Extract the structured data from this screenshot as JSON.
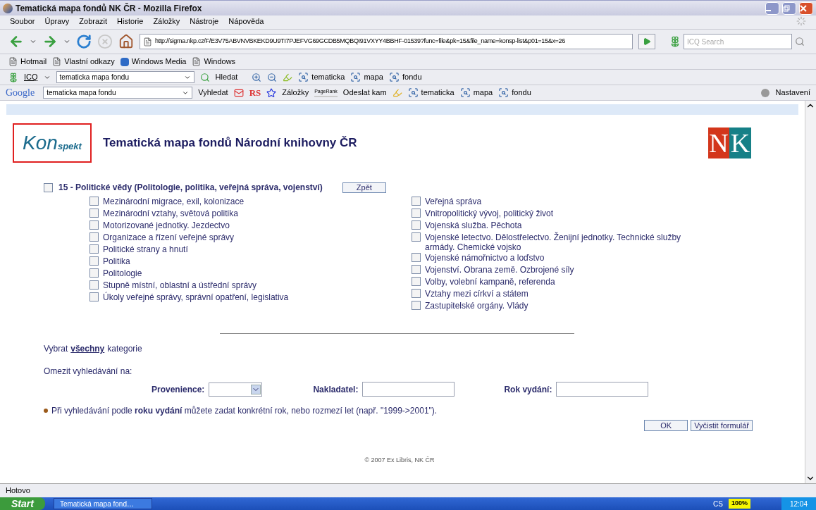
{
  "window": {
    "title": "Tematická mapa fondů NK ČR - Mozilla Firefox"
  },
  "menu": [
    "Soubor",
    "Úpravy",
    "Zobrazit",
    "Historie",
    "Záložky",
    "Nástroje",
    "Nápověda"
  ],
  "navigation": {
    "url": "http://sigma.nkp.cz/F/E3V75ABVNVBKEKD9U9TI7PJEFVG69GCDB5MQBQI91VXYY4BBHF-01539?func=file&pk=15&file_name=konsp-list&p01=15&x=26",
    "search_placeholder": "ICQ Search"
  },
  "bookmarks": [
    {
      "label": "Hotmail",
      "kind": "page"
    },
    {
      "label": "Vlastní odkazy",
      "kind": "page"
    },
    {
      "label": "Windows Media",
      "kind": "media"
    },
    {
      "label": "Windows",
      "kind": "page"
    }
  ],
  "icq_toolbar": {
    "label": "ICQ",
    "query": "tematicka mapa fondu",
    "search": "Hledat",
    "terms": [
      "tematicka",
      "mapa",
      "fondu"
    ]
  },
  "google_toolbar": {
    "logo": "Google",
    "query": "tematicka mapa fondu",
    "search": "Vyhledat",
    "rs": "RS",
    "bookmarks": "Záložky",
    "pagerank": "PageRank",
    "send": "Odeslat kam",
    "terms": [
      "tematicka",
      "mapa",
      "fondu"
    ],
    "settings": "Nastavení"
  },
  "page": {
    "logo": {
      "big": "Kon",
      "small": "spekt"
    },
    "title": "Tematická mapa fondů Národní knihovny ČR",
    "nk_logo": [
      "N",
      "K"
    ],
    "category": {
      "number": "15 -",
      "title": "Politické vědy (Politologie, politika, veřejná správa, vojenství)",
      "checked": false
    },
    "back_button": "Zpět",
    "left_items": [
      {
        "label": "Mezinárodní migrace, exil, kolonizace",
        "checked": false
      },
      {
        "label": "Mezinárodní vztahy, světová politika",
        "checked": false
      },
      {
        "label": "Motorizované jednotky. Jezdectvo",
        "checked": false
      },
      {
        "label": "Organizace a řízení veřejné správy",
        "checked": false
      },
      {
        "label": "Politické strany a hnutí",
        "checked": false
      },
      {
        "label": "Politika",
        "checked": false
      },
      {
        "label": "Politologie",
        "checked": false
      },
      {
        "label": "Stupně místní, oblastní a ústřední správy",
        "checked": false
      },
      {
        "label": "Úkoly veřejné správy, správní opatření, legislativa",
        "checked": false
      }
    ],
    "right_items": [
      {
        "label": "Veřejná správa",
        "checked": false
      },
      {
        "label": "Vnitropolitický vývoj, politický život",
        "checked": false
      },
      {
        "label": "Vojenská služba. Pěchota",
        "checked": false
      },
      {
        "label": "Vojenské letectvo. Dělostřelectvo. Ženijní jednotky. Technické služby armády. Chemické vojsko",
        "checked": false
      },
      {
        "label": "Vojenské námořnictvo a loďstvo",
        "checked": false
      },
      {
        "label": "Vojenství. Obrana země. Ozbrojené síly",
        "checked": false
      },
      {
        "label": "Volby, volební kampaně, referenda",
        "checked": false
      },
      {
        "label": "Vztahy mezi církví a státem",
        "checked": false
      },
      {
        "label": "Zastupitelské orgány. Vlády",
        "checked": false
      }
    ],
    "select_all": {
      "before": "Vybrat",
      "link": "všechny",
      "after": "kategorie"
    },
    "limit_label": "Omezit vyhledávání na:",
    "fields": [
      {
        "label": "Provenience:",
        "kind": "select"
      },
      {
        "label": "Nakladatel:",
        "kind": "text"
      },
      {
        "label": "Rok vydání:",
        "kind": "text"
      }
    ],
    "note": "Při vyhledávání podle **roku vydání** můžete zadat konkrétní rok, nebo rozmezí let (např. \"1999->2001\").",
    "buttons": [
      "OK",
      "Vyčistit formulář"
    ],
    "footer": "© 2007 Ex Libris, NK ČR"
  },
  "status_bar": "Hotovo",
  "taskbar": {
    "start": "Start",
    "task": "Tematická mapa fond…",
    "language": "CS",
    "zoom": "100%",
    "clock": "12:04"
  }
}
